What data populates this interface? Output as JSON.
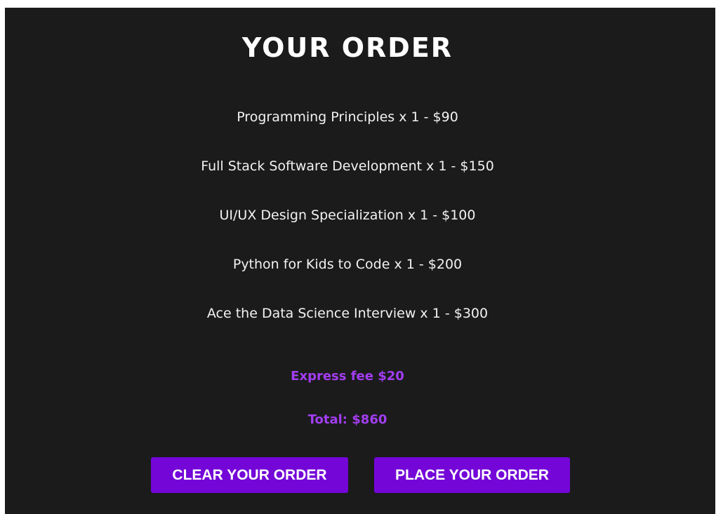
{
  "colors": {
    "panel_background": "#1b1b1b",
    "accent_text": "#a33df2",
    "button_background": "#7406d8"
  },
  "order": {
    "title": "YOUR ORDER",
    "items": [
      "Programming Principles x 1 - $90",
      "Full Stack Software Development x 1 - $150",
      "UI/UX Design Specialization x 1 - $100",
      "Python for Kids to Code x 1 - $200",
      "Ace the Data Science Interview x 1 - $300"
    ],
    "express_fee": "Express fee $20",
    "total": "Total: $860"
  },
  "actions": {
    "clear_label": "CLEAR YOUR ORDER",
    "place_label": "PLACE YOUR ORDER"
  }
}
